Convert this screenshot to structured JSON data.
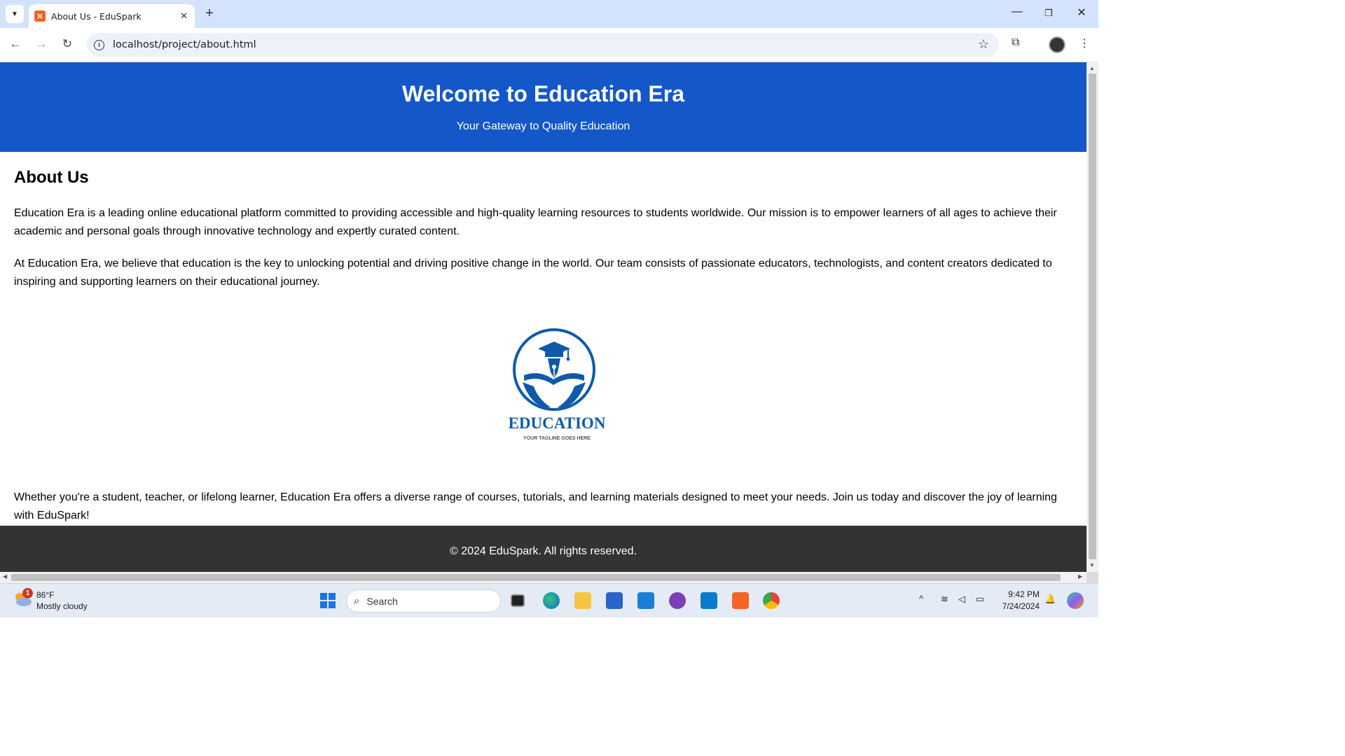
{
  "browser": {
    "tab_title": "About Us - EduSpark",
    "url": "localhost/project/about.html"
  },
  "site": {
    "header_title": "Welcome to Education Era",
    "header_subtitle": "Your Gateway to Quality Education",
    "section_heading": "About Us",
    "paragraphs": [
      "Education Era is a leading online educational platform committed to providing accessible and high-quality learning resources to students worldwide. Our mission is to empower learners of all ages to achieve their academic and personal goals through innovative technology and expertly curated content.",
      "At Education Era, we believe that education is the key to unlocking potential and driving positive change in the world. Our team consists of passionate educators, technologists, and content creators dedicated to inspiring and supporting learners on their educational journey.",
      "Whether you're a student, teacher, or lifelong learner, Education Era offers a diverse range of courses, tutorials, and learning materials designed to meet your needs. Join us today and discover the joy of learning with EduSpark!"
    ],
    "logo": {
      "wordmark": "EDUCATION",
      "tagline": "YOUR TAGLINE GOES HERE"
    },
    "footer_text": "© 2024 EduSpark. All rights reserved.",
    "colors": {
      "header_bg": "#1357c9",
      "footer_bg": "#333333",
      "logo_blue": "#0f5aa8"
    }
  },
  "taskbar": {
    "weather_badge": "1",
    "weather_temp": "86°F",
    "weather_condition": "Mostly cloudy",
    "search_label": "Search",
    "time": "9:42 PM",
    "date": "7/24/2024"
  }
}
